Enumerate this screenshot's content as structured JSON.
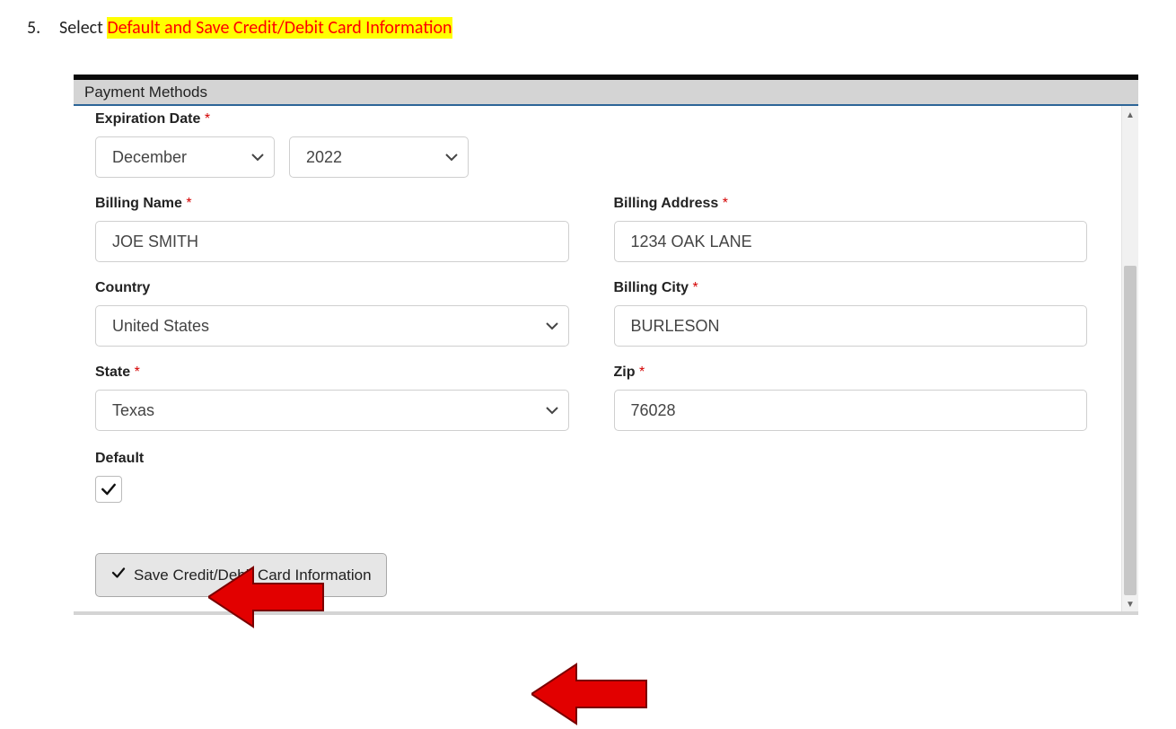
{
  "step": {
    "number": "5.",
    "prefix": "Select ",
    "highlight": "Default and Save Credit/Debit Card Information"
  },
  "section_title": "Payment Methods",
  "labels": {
    "expiration": "Expiration Date",
    "billing_name": "Billing Name",
    "billing_address": "Billing Address",
    "country": "Country",
    "billing_city": "Billing City",
    "state": "State",
    "zip": "Zip",
    "default": "Default"
  },
  "values": {
    "exp_month": "December",
    "exp_year": "2022",
    "billing_name": "JOE SMITH",
    "billing_address": "1234 OAK LANE",
    "country": "United States",
    "billing_city": "BURLESON",
    "state": "Texas",
    "zip": "76028",
    "default_checked": true
  },
  "buttons": {
    "save": "Save Credit/Debit Card Information"
  },
  "required_marker": "*"
}
